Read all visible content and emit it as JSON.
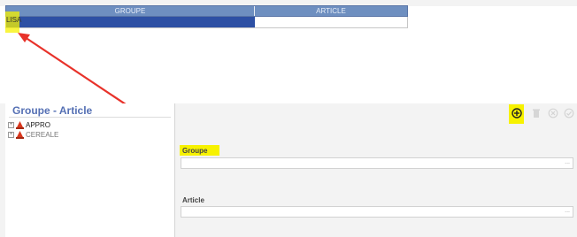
{
  "mini_table": {
    "headers": [
      "GROUPE",
      "ARTICLE"
    ],
    "selected_row": {
      "groupe": "LISA",
      "article": ""
    }
  },
  "panel": {
    "title": "Groupe - Article",
    "tree": [
      {
        "label": "APPRO",
        "icon": "cone-icon",
        "expander": "+"
      },
      {
        "label": "CEREALE",
        "icon": "cone-icon",
        "expander": "+"
      }
    ],
    "toolbar": {
      "add_icon": "add-circle-icon",
      "delete_icon": "trash-icon",
      "cancel_icon": "cancel-circle-icon",
      "validate_icon": "check-circle-icon"
    },
    "form": {
      "groupe_label": "Groupe",
      "groupe_value": "",
      "article_label": "Article",
      "article_value": "",
      "picker": "..."
    }
  },
  "colors": {
    "highlight": "#f7f200",
    "arrow": "#e8322a",
    "selected_row": "#2d50a4",
    "header": "#6e8fc0",
    "title": "#5570b4",
    "tree_icon": "#d9361c"
  }
}
